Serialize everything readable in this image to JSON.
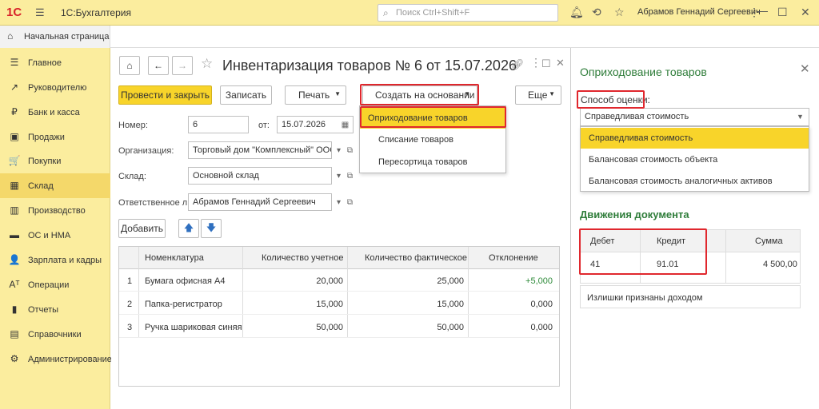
{
  "app": {
    "logo": "1С",
    "logo_menu": "☰",
    "title": "1С:Бухгалтерия",
    "search_placeholder": "Поиск Ctrl+Shift+F",
    "user": "Абрамов Геннадий Сергеевич"
  },
  "tabs": {
    "home": "Начальная страница"
  },
  "sidebar": {
    "items": [
      {
        "label": "Главное",
        "icon": "☰"
      },
      {
        "label": "Руководителю",
        "icon": "↗"
      },
      {
        "label": "Банк и касса",
        "icon": "₽"
      },
      {
        "label": "Продажи",
        "icon": "▣"
      },
      {
        "label": "Покупки",
        "icon": "🛒"
      },
      {
        "label": "Склад",
        "icon": "▦"
      },
      {
        "label": "Производство",
        "icon": "▥"
      },
      {
        "label": "ОС и НМА",
        "icon": "▬"
      },
      {
        "label": "Зарплата и кадры",
        "icon": "👤"
      },
      {
        "label": "Операции",
        "icon": "Aᵀ"
      },
      {
        "label": "Отчеты",
        "icon": "▮"
      },
      {
        "label": "Справочники",
        "icon": "▤"
      },
      {
        "label": "Администрирование",
        "icon": "⚙"
      }
    ],
    "active_index": 5
  },
  "document": {
    "title": "Инвентаризация товаров № 6 от 15.07.2026",
    "buttons": {
      "post_close": "Провести и закрыть",
      "save": "Записать",
      "print": "Печать",
      "create_based": "Создать на основании",
      "more": "Еще",
      "add": "Добавить"
    },
    "fields": {
      "number_label": "Номер:",
      "number": "6",
      "date_label": "от:",
      "date": "15.07.2026",
      "org_label": "Организация:",
      "org": "Торговый дом \"Комплексный\" ООО",
      "warehouse_label": "Склад:",
      "warehouse": "Основной склад",
      "responsible_label": "Ответственное лицо:",
      "responsible": "Абрамов Геннадий Сергеевич"
    },
    "create_menu": [
      "Оприходование товаров",
      "Списание товаров",
      "Пересортица товаров"
    ],
    "table": {
      "headers": [
        "Номенклатура",
        "Количество учетное",
        "Количество фактическое",
        "Отклонение"
      ],
      "rows": [
        {
          "n": "1",
          "name": "Бумага офисная А4",
          "acc": "20,000",
          "fact": "25,000",
          "dev": "+5,000"
        },
        {
          "n": "2",
          "name": "Папка-регистратор",
          "acc": "15,000",
          "fact": "15,000",
          "dev": "0,000"
        },
        {
          "n": "3",
          "name": "Ручка шариковая синяя",
          "acc": "50,000",
          "fact": "50,000",
          "dev": "0,000"
        }
      ]
    }
  },
  "panel": {
    "title": "Оприходование товаров",
    "valuation_label": "Способ оценки:",
    "valuation_value": "Справедливая стоимость",
    "valuation_options": [
      "Справедливая стоимость",
      "Балансовая стоимость объекта",
      "Балансовая стоимость аналогичных активов"
    ],
    "movements_title": "Движения документа",
    "movements": {
      "headers": [
        "Дебет",
        "Кредит",
        "Сумма"
      ],
      "debit": "41",
      "credit": "91.01",
      "sum": "4 500,00"
    },
    "note": "Излишки признаны доходом"
  },
  "colors": {
    "accent_yellow": "#f8d42a",
    "sidebar_bg": "#fbed9e",
    "highlight_red": "#e0272d",
    "green_title": "#2f7d3a",
    "positive_green": "#2e8b3a"
  }
}
